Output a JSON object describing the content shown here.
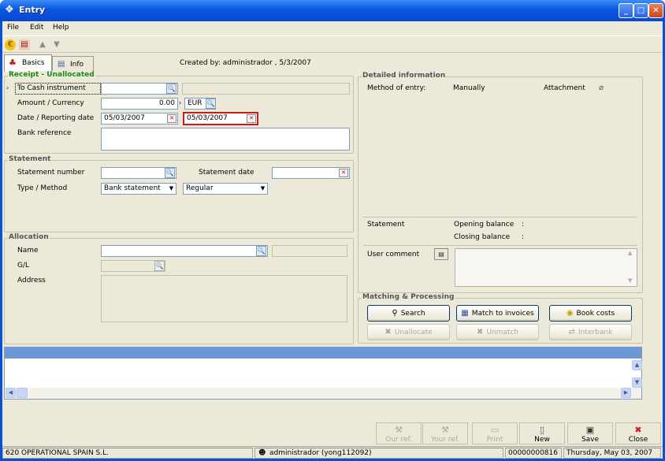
{
  "window": {
    "title": "Entry",
    "minimize": "_",
    "maximize": "□",
    "close": "✕"
  },
  "menu": {
    "file": "File",
    "edit": "Edit",
    "help": "Help"
  },
  "tabs": {
    "basics": "Basics",
    "info": "Info"
  },
  "created_by": "Created by: administrador , 5/3/2007",
  "receipt": {
    "legend": "Receipt - Unallocated",
    "legend_color": "#1b8a1b",
    "to_cash_label": "To Cash instrument",
    "to_cash_value": "",
    "amount_label": "Amount / Currency",
    "amount_value": "0.00",
    "currency_value": "EUR",
    "date_label": "Date / Reporting date",
    "date_value": "05/03/2007",
    "reporting_date_value": "05/03/2007",
    "bank_ref_label": "Bank reference",
    "bank_ref_value": ""
  },
  "statement": {
    "legend": "Statement",
    "number_label": "Statement number",
    "number_value": "",
    "date_label": "Statement date",
    "date_value": "",
    "type_label": "Type / Method",
    "type_value": "Bank statement",
    "method_value": "Regular"
  },
  "allocation": {
    "legend": "Allocation",
    "name_label": "Name",
    "name_value": "",
    "gl_label": "G/L",
    "gl_value": "",
    "address_label": "Address",
    "address_value": ""
  },
  "detailed": {
    "legend": "Detailed information",
    "method_label": "Method of entry:",
    "method_value": "Manually",
    "attachment_label": "Attachment",
    "statement_label": "Statement",
    "opening_label": "Opening balance",
    "opening_value": ":",
    "closing_label": "Closing balance",
    "closing_value": ":",
    "user_comment_label": "User comment",
    "user_comment_value": ""
  },
  "matching": {
    "legend": "Matching & Processing",
    "search": "Search",
    "match": "Match to invoices",
    "book": "Book costs",
    "unallocate": "Unallocate",
    "unmatch": "Unmatch",
    "interbank": "Interbank"
  },
  "bottom": {
    "our_ref": "Our ref.",
    "your_ref": "Your ref.",
    "print": "Print",
    "new": "New",
    "save": "Save",
    "close": "Close"
  },
  "status": {
    "company": "620 OPERATIONAL SPAIN S.L.",
    "user": "administrador (yong112092)",
    "number": "00000000816",
    "date": "Thursday, May 03, 2007"
  },
  "colors": {
    "title_blue": "#0a56e3",
    "panel_bg": "#ece9d8",
    "grid_header": "#6d98d8",
    "highlight_red": "#d01818"
  }
}
